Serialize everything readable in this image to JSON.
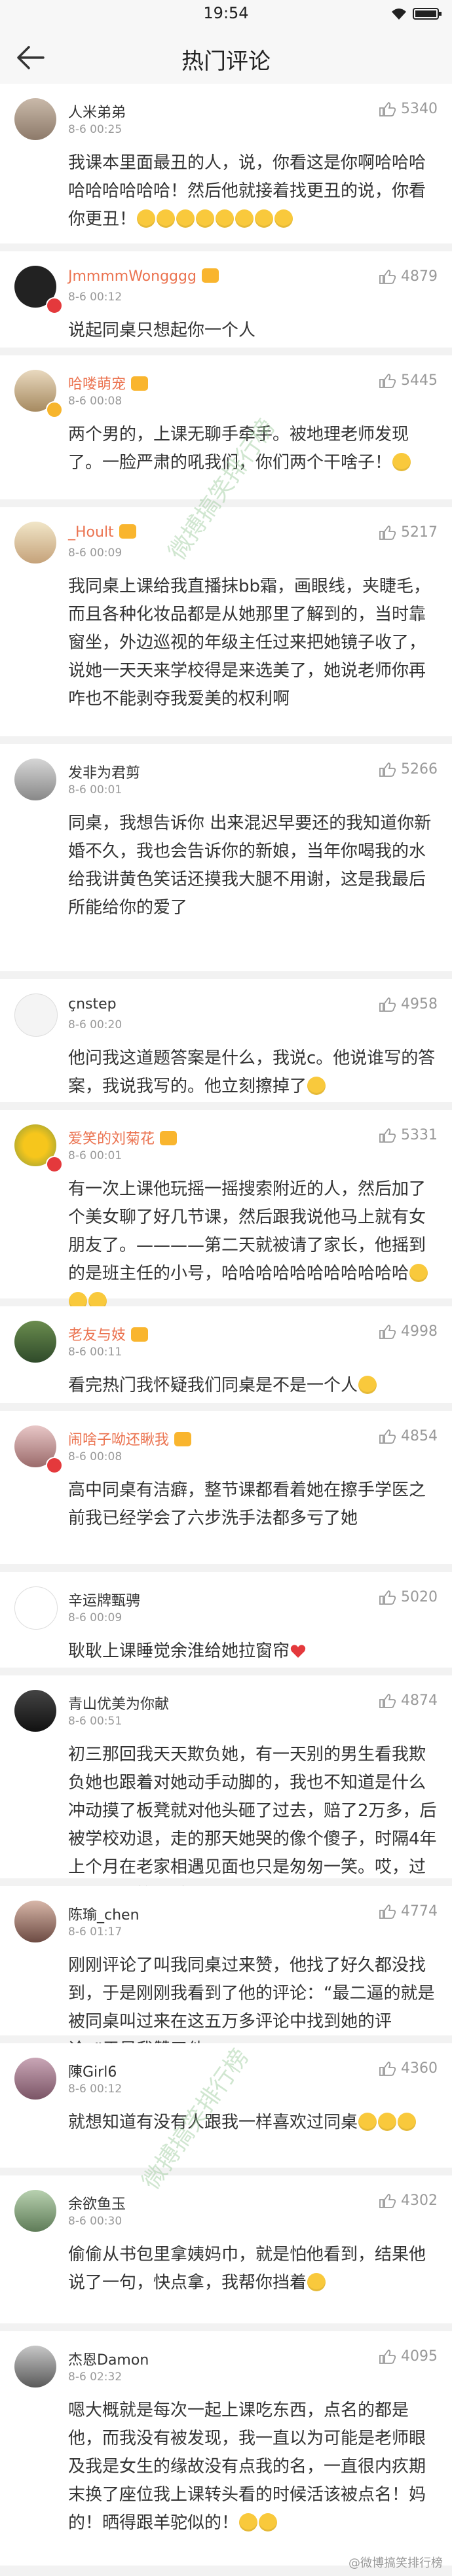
{
  "status_bar": {
    "time": "19:54"
  },
  "nav": {
    "title": "热门评论"
  },
  "comments": [
    {
      "name": "人米弟弟",
      "time": "8-6 00:25",
      "likes": "5340",
      "text": "我课本里面最丑的人，说，你看这是你啊哈哈哈哈哈哈哈哈哈！然后他就接着找更丑的说，你看你更丑！"
    },
    {
      "name": "JmmmmWongggg",
      "time": "8-6 00:12",
      "likes": "4879",
      "text": "说起同桌只想起你一个人"
    },
    {
      "name": "哈喽萌宠",
      "time": "8-6 00:08",
      "likes": "5445",
      "text": "两个男的，上课无聊手牵手。被地理老师发现了。一脸严肃的吼我们，你们两个干啥子！"
    },
    {
      "name": "_Hoult",
      "time": "8-6 00:09",
      "likes": "5217",
      "text": "我同桌上课给我直播抹bb霜，画眼线，夹睫毛，而且各种化妆品都是从她那里了解到的，当时靠窗坐，外边巡视的年级主任过来把她镜子收了，说她一天天来学校得是来选美了，她说老师你再咋也不能剥夺我爱美的权利啊"
    },
    {
      "name": "发非为君剪",
      "time": "8-6 00:01",
      "likes": "5266",
      "text": "同桌，我想告诉你 出来混迟早要还的我知道你新婚不久，我也会告诉你的新娘，当年你喝我的水给我讲黄色笑话还摸我大腿不用谢，这是我最后所能给你的爱了"
    },
    {
      "name": "çnstep",
      "time": "8-6 00:20",
      "likes": "4958",
      "text": "他问我这道题答案是什么，我说c。他说谁写的答案，我说我写的。他立刻擦掉了"
    },
    {
      "name": "爱笑的刘菊花",
      "time": "8-6 00:01",
      "likes": "5331",
      "text": "有一次上课他玩摇一摇搜索附近的人，然后加了个美女聊了好几节课，然后跟我说他马上就有女朋友了。————第二天就被请了家长，他摇到的是班主任的小号，哈哈哈哈哈哈哈哈哈哈哈"
    },
    {
      "name": "老友与妓",
      "time": "8-6 00:11",
      "likes": "4998",
      "text": "看完热门我怀疑我们同桌是不是一个人"
    },
    {
      "name": "闹啥子呦还瞅我",
      "time": "8-6 00:08",
      "likes": "4854",
      "text": "高中同桌有洁癖，整节课都看着她在擦手学医之前我已经学会了六步洗手法都多亏了她"
    },
    {
      "name": "辛运牌甄骋",
      "time": "8-6 00:09",
      "likes": "5020",
      "text": "耿耿上课睡觉余淮给她拉窗帘"
    },
    {
      "name": "青山优美为你献",
      "time": "8-6 00:51",
      "likes": "4874",
      "text": "初三那回我天天欺负她，有一天别的男生看我欺负她也跟着对她动手动脚的，我也不知道是什么冲动摸了板凳就对他头砸了过去，赔了2万多，后被学校劝退，走的那天她哭的像个傻子，时隔4年上个月在老家相遇见面也只是匆匆一笑。哎，过眼云烟一笑而过……"
    },
    {
      "name": "陈瑜_chen",
      "time": "8-6 01:17",
      "likes": "4774",
      "text": "刚刚评论了叫我同桌过来赞，他找了好久都没找到，于是刚刚我看到了他的评论：“最二逼的就是被同桌叫过来在这五万多评论中找到她的评论。”于是我赞了他"
    },
    {
      "name": "陳Girl6",
      "time": "8-6 00:12",
      "likes": "4360",
      "text": "就想知道有没有人跟我一样喜欢过同桌"
    },
    {
      "name": "余欲鱼玉",
      "time": "8-6 00:30",
      "likes": "4302",
      "text": "偷偷从书包里拿姨妈巾，就是怕他看到，结果他说了一句，快点拿，我帮你挡着"
    },
    {
      "name": "杰恩Damon",
      "time": "8-6 02:32",
      "likes": "4095",
      "text": "嗯大概就是每次一起上课吃东西，点名的都是他，而我没有被发现，我一直以为可能是老师眼及我是女生的缘故没有点我的名，一直很内疚期末换了座位我上课转头看的时候活该被点名！妈的！晒得跟羊驼似的！"
    }
  ],
  "watermarks": {
    "center": "微搏搞笑排行榜",
    "footer": "@微博搞笑排行榜"
  }
}
